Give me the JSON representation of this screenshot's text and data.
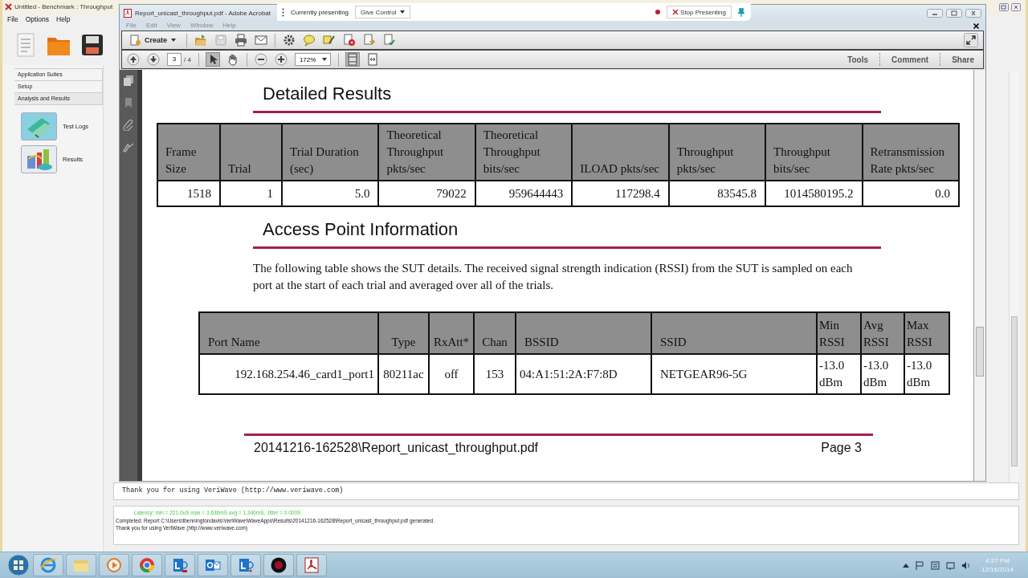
{
  "background_window": {
    "title": "Untitled - Benchmark : Throughput",
    "menu": [
      "File",
      "Options",
      "Help"
    ],
    "sidebar": [
      {
        "label": "Application Suites",
        "expanded": false
      },
      {
        "label": "Setup",
        "expanded": false
      },
      {
        "label": "Analysis and Results",
        "expanded": true,
        "children": [
          {
            "label": "Test Logs"
          },
          {
            "label": "Results"
          }
        ]
      }
    ],
    "log_text": "Thank you for using VeriWave (http://www.veriwave.com)",
    "status_lines": [
      {
        "kind": "latency",
        "text": "Latency: min = 221.0uS max = 3.636mS avg = 1.340mS, Jitter = 0.000S"
      },
      {
        "kind": "plain",
        "text": "Completed: Report C:\\Users\\tbenningtondavis\\VeriWave\\WaveApps\\Results\\20141216-162528\\Report_unicast_throughput.pdf generated."
      },
      {
        "kind": "plain",
        "text": "Thank you for using VeriWave (http://www.veriwave.com)"
      }
    ]
  },
  "acrobat": {
    "title": "Report_unicast_throughput.pdf - Adobe Acrobat",
    "menu": {
      "disabled": true,
      "items": [
        "File",
        "Edit",
        "View",
        "Window",
        "Help"
      ]
    },
    "create_label": "Create",
    "page": "3",
    "page_total": "/ 4",
    "zoom": "172%",
    "pane_tabs": [
      "Tools",
      "Comment",
      "Share"
    ],
    "document": {
      "blocks": [
        {
          "kind": "heading",
          "text": "Detailed Results"
        },
        {
          "kind": "table",
          "columns": [
            "Frame Size",
            "Trial",
            "Trial Duration (sec)",
            "Theoretical Throughput pkts/sec",
            "Theoretical Throughput bits/sec",
            "ILOAD pkts/sec",
            "Throughput pkts/sec",
            "Throughput bits/sec",
            "Retransmission Rate pkts/sec"
          ],
          "rows": [
            [
              "1518",
              "1",
              "5.0",
              "79022",
              "959644443",
              "117298.4",
              "83545.8",
              "1014580195.2",
              "0.0"
            ]
          ]
        },
        {
          "kind": "heading",
          "text": "Access Point Information"
        },
        {
          "kind": "paragraph",
          "text": "The following table shows the SUT details. The received signal strength indication (RSSI) from the SUT is sampled on each port at the start of each trial and averaged over all of the trials."
        },
        {
          "kind": "table",
          "columns": [
            "Port Name",
            "Type",
            "RxAtt*",
            "Chan",
            "BSSID",
            "SSID",
            "Min RSSI",
            "Avg RSSI",
            "Max RSSI"
          ],
          "rows": [
            [
              "192.168.254.46_card1_port1",
              "80211ac",
              "off",
              "153",
              "04:A1:51:2A:F7:8D",
              "NETGEAR96-5G",
              "-13.0 dBm",
              "-13.0 dBm",
              "-13.0 dBm"
            ]
          ]
        }
      ],
      "footer": {
        "file": "20141216-162528\\Report_unicast_throughput.pdf",
        "page": "Page 3"
      }
    }
  },
  "presenting_bar": {
    "label": "Currently presenting",
    "give_control": "Give Control",
    "stop": "Stop Presenting"
  },
  "taskbar": {
    "time": "4:27 PM",
    "date": "12/16/2014"
  }
}
